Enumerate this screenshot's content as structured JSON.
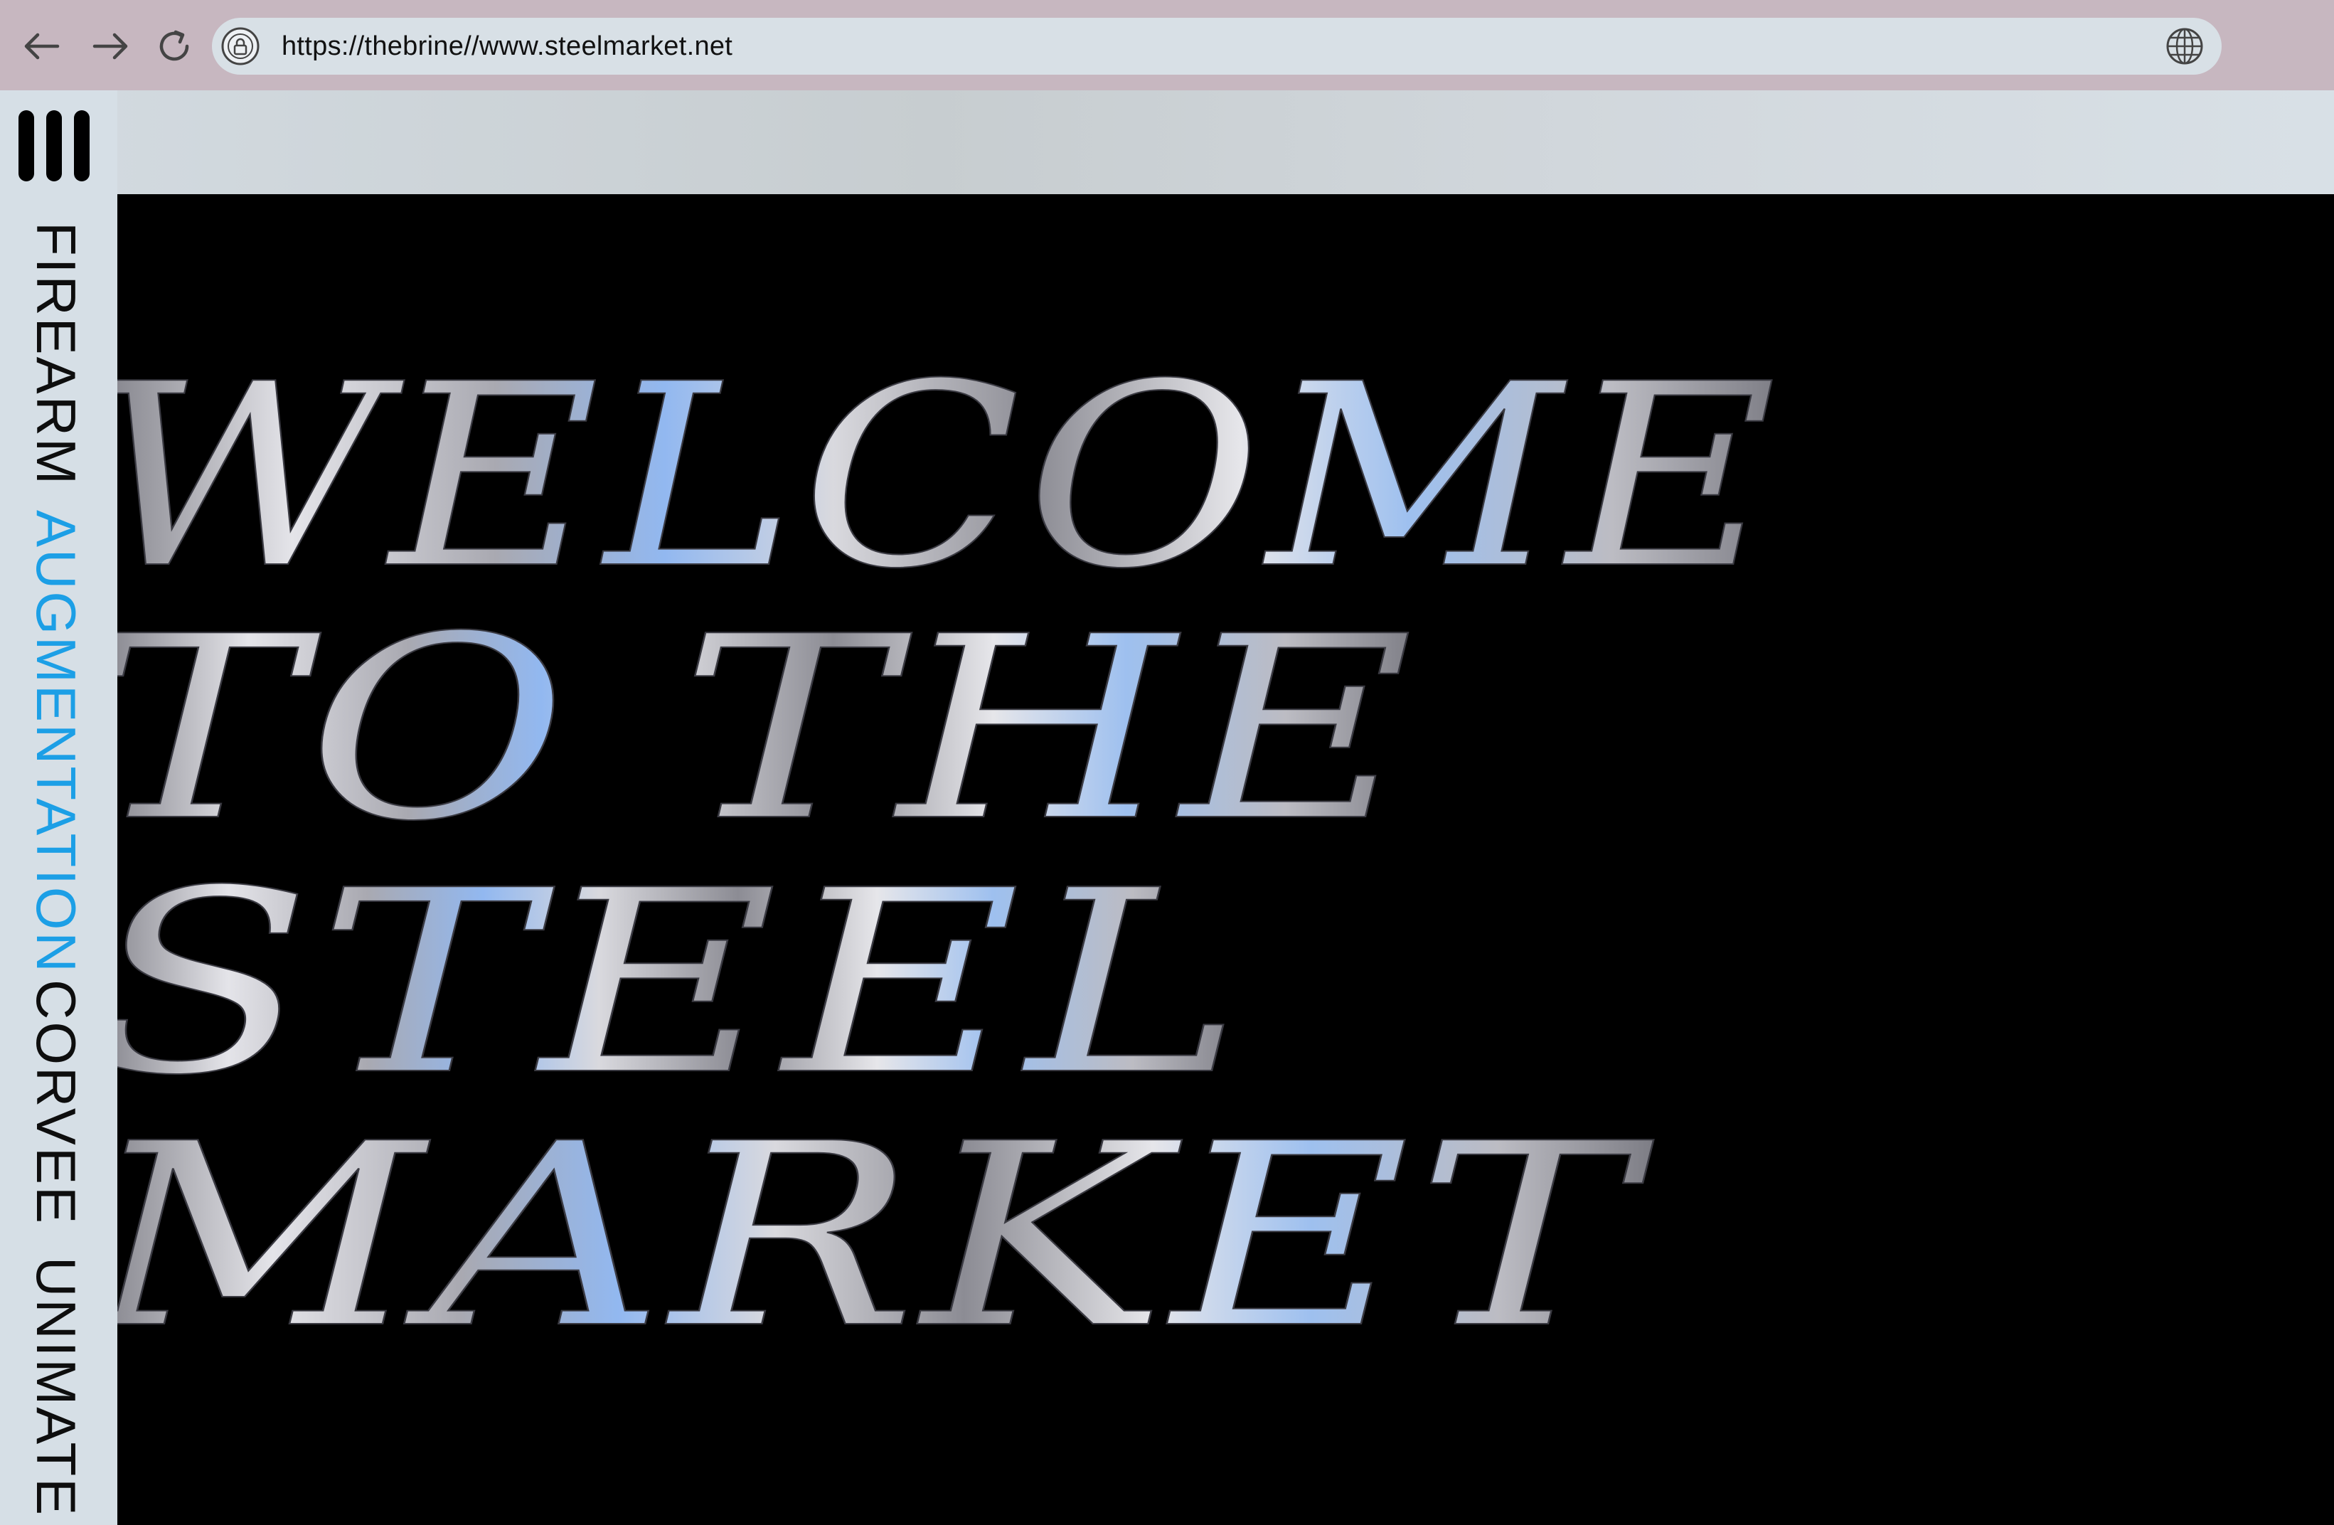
{
  "browser": {
    "url": "https://thebrine//www.steelmarket.net",
    "icons": [
      "back-arrow-icon",
      "forward-arrow-icon",
      "reload-icon",
      "lock-icon",
      "globe-icon"
    ]
  },
  "sidebar": {
    "menu_icon": "menu-icon",
    "items": [
      {
        "label": "FIREARM",
        "active": false
      },
      {
        "label": "AUGMENTATION",
        "active": true
      },
      {
        "label": "CORVEE",
        "active": false
      },
      {
        "label": "UNIMATE",
        "active": false
      }
    ],
    "active_color": "#1c9fe6"
  },
  "hero": {
    "lines": [
      "WELCOME",
      "TO THE",
      "STEEL",
      "MARKET"
    ]
  },
  "colors": {
    "chrome": "#c7b7c0",
    "address_bar": "#d8e0e6",
    "sidebar": "#d6dfe6",
    "hero_bg": "#000000",
    "chrome_text_silver": "#c8c8ce",
    "chrome_text_blue": "#8fb4ec"
  }
}
